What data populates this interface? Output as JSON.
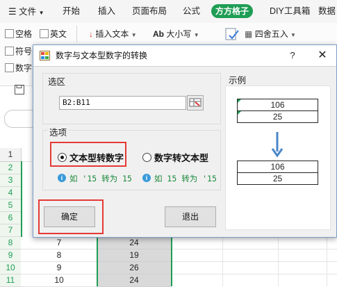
{
  "ribbon": {
    "menu_label": "文件",
    "tabs": [
      "开始",
      "插入",
      "页面布局",
      "公式",
      "方方格子",
      "DIY工具箱",
      "数据"
    ],
    "active_tab": "方方格子",
    "checkboxes": [
      "空格",
      "英文",
      "符号",
      "数字"
    ],
    "tools": {
      "insert_text": "插入文本",
      "case": "大小写",
      "round": "四舍五入",
      "case_prefix": "Ab"
    }
  },
  "sheet": {
    "row_numbers": [
      "1",
      "2",
      "3",
      "4",
      "5",
      "6",
      "7",
      "8",
      "9",
      "10",
      "11"
    ],
    "visible_rows": [
      {
        "a": "7",
        "b": "24"
      },
      {
        "a": "8",
        "b": "19"
      },
      {
        "a": "9",
        "b": "26"
      },
      {
        "a": "10",
        "b": "24"
      }
    ]
  },
  "dialog": {
    "title": "数字与文本型数字的转换",
    "help_label": "?",
    "close_label": "✕",
    "range_group": "选区",
    "range_value": "B2:B11",
    "options_group": "选项",
    "option_text_to_number": "文本型转数字",
    "option_number_to_text": "数字转文本型",
    "selected_option": "文本型转数字",
    "hint_1": "如 '15 转为 15",
    "hint_2": "如 15 转为 '15",
    "confirm": "确定",
    "exit": "退出",
    "example_group": "示例",
    "example_before": [
      "106",
      "25"
    ],
    "example_after": [
      "106",
      "25"
    ]
  },
  "colors": {
    "accent_green": "#1f9d55",
    "highlight_red": "#e53935",
    "arrow_blue": "#4a86c8",
    "hint_green": "#1c8a3c"
  }
}
